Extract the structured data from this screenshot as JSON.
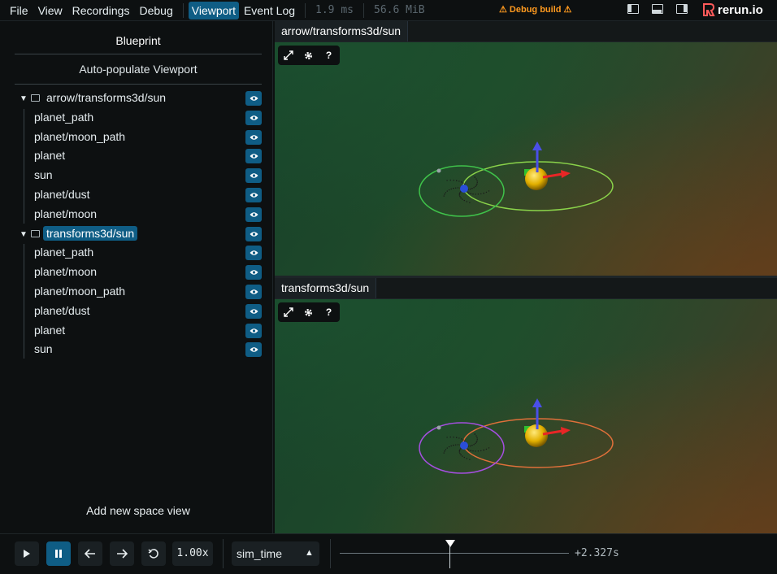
{
  "menu": {
    "items": [
      "File",
      "View",
      "Recordings",
      "Debug"
    ],
    "active_tabs": [
      "Viewport",
      "Event Log"
    ],
    "active_index": 0,
    "frame_time": "1.9 ms",
    "memory": "56.6 MiB",
    "debug_build": "⚠ Debug build ⚠",
    "logo_text": "rerun.io"
  },
  "blueprint": {
    "title": "Blueprint",
    "auto_populate": "Auto-populate Viewport",
    "add_space_view": "Add new space view",
    "groups": [
      {
        "name": "arrow/transforms3d/sun",
        "selected": false,
        "children": [
          "planet_path",
          "planet/moon_path",
          "planet",
          "sun",
          "planet/dust",
          "planet/moon"
        ]
      },
      {
        "name": "transforms3d/sun",
        "selected": true,
        "children": [
          "planet_path",
          "planet/moon",
          "planet/moon_path",
          "planet/dust",
          "planet",
          "sun"
        ]
      }
    ]
  },
  "views": [
    {
      "tab_label": "arrow/transforms3d/sun",
      "planet_orbit_color": "#8ad34a",
      "moon_orbit_color": "#3fc24a"
    },
    {
      "tab_label": "transforms3d/sun",
      "planet_orbit_color": "#e0703a",
      "moon_orbit_color": "#a54fe0"
    }
  ],
  "canvas_tools": [
    "expand-icon",
    "gear-icon",
    "help-icon"
  ],
  "canvas_help": "?",
  "timeline": {
    "speed": "1.00x",
    "name": "sim_time",
    "time": "+2.327s",
    "playing": true
  },
  "colors": {
    "accent": "#0f5d85",
    "background": "#0d1011",
    "warning": "#ff9a1f"
  }
}
